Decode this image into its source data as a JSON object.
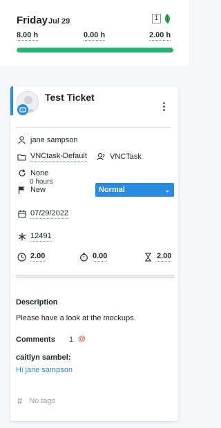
{
  "day": {
    "name": "Friday",
    "date": "Jul 29",
    "badge_count": "1",
    "hours": [
      "8.00 h",
      "0.00 h",
      "2.00 h"
    ],
    "progress_fraction": 1.0,
    "progress_color": "#25b573"
  },
  "ticket": {
    "title": "Test Ticket",
    "assignee": "jane sampson",
    "project": "VNCtask-Default",
    "project_type": "VNCTask",
    "recurrence": "None",
    "status": "New",
    "estimated": "0 hours",
    "priority": "Normal",
    "due_date": "07/29/2022",
    "ticket_id": "12491",
    "time": {
      "spent": "2.00",
      "timer": "0.00",
      "remaining": "2.00"
    },
    "time_progress_fraction": 0.0,
    "description_title": "Description",
    "description": "Please have a look at the mockups.",
    "comments_title": "Comments",
    "comments_count": "1",
    "mention_symbol": "@",
    "comment": {
      "author": "caitlyn sambel:",
      "greeting": "Hi ",
      "mention": "jane sampson"
    },
    "tags_placeholder": "No tags"
  },
  "colors": {
    "accent": "#2a8ce0",
    "progress": "#25b573",
    "mention": "#e8503a"
  },
  "icons": [
    "leaf-icon",
    "person-icon",
    "folder-icon",
    "user-group-icon",
    "refresh-icon",
    "flag-icon",
    "calendar-icon",
    "asterisk-icon",
    "clock-icon",
    "stopwatch-icon",
    "hourglass-icon",
    "kebab-menu-icon",
    "hash-icon",
    "ticket-icon"
  ]
}
